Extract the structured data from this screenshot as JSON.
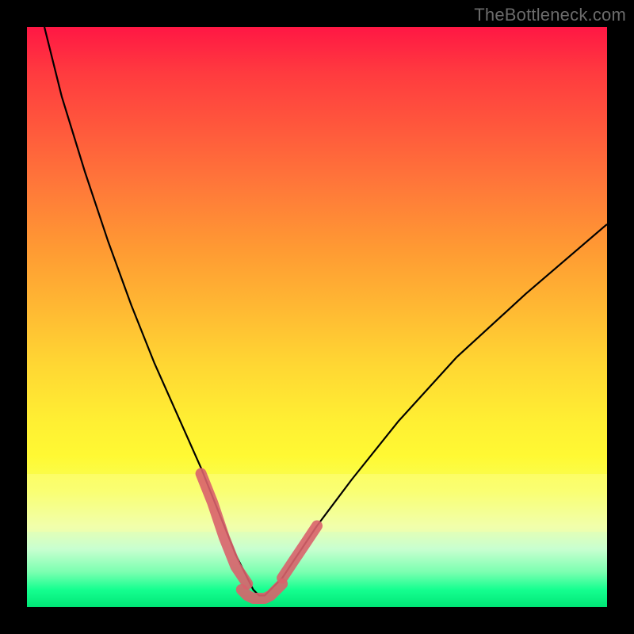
{
  "watermark": "TheBottleneck.com",
  "chart_data": {
    "type": "line",
    "title": "",
    "xlabel": "",
    "ylabel": "",
    "xlim": [
      0,
      100
    ],
    "ylim": [
      0,
      100
    ],
    "grid": false,
    "legend": false,
    "background": {
      "gradient": "red-to-green-vertical",
      "colors_top_to_bottom": [
        "#ff1744",
        "#ff9933",
        "#ffef33",
        "#00e676"
      ]
    },
    "series": [
      {
        "name": "bottleneck-curve",
        "stroke": "#000000",
        "x": [
          3,
          6,
          10,
          14,
          18,
          22,
          26,
          30,
          32,
          34,
          36,
          38,
          39,
          40,
          41,
          42,
          44,
          46,
          50,
          56,
          64,
          74,
          86,
          100
        ],
        "y": [
          100,
          88,
          75,
          63,
          52,
          42,
          33,
          24,
          19,
          14,
          9,
          5,
          3,
          2,
          2,
          3,
          5,
          8,
          14,
          22,
          32,
          43,
          54,
          66
        ]
      },
      {
        "name": "highlight-band-left",
        "stroke": "#d9626c",
        "thick": true,
        "x": [
          30,
          32,
          34,
          36,
          38
        ],
        "y": [
          23,
          18,
          12,
          7,
          4
        ]
      },
      {
        "name": "highlight-band-bottom",
        "stroke": "#d9626c",
        "thick": true,
        "x": [
          37,
          38,
          39,
          40,
          41,
          42,
          43,
          44
        ],
        "y": [
          3,
          2,
          1.5,
          1.5,
          1.5,
          2,
          3,
          4
        ]
      },
      {
        "name": "highlight-band-right",
        "stroke": "#d9626c",
        "thick": true,
        "x": [
          44,
          46,
          48,
          50
        ],
        "y": [
          5,
          8,
          11,
          14
        ]
      }
    ]
  }
}
